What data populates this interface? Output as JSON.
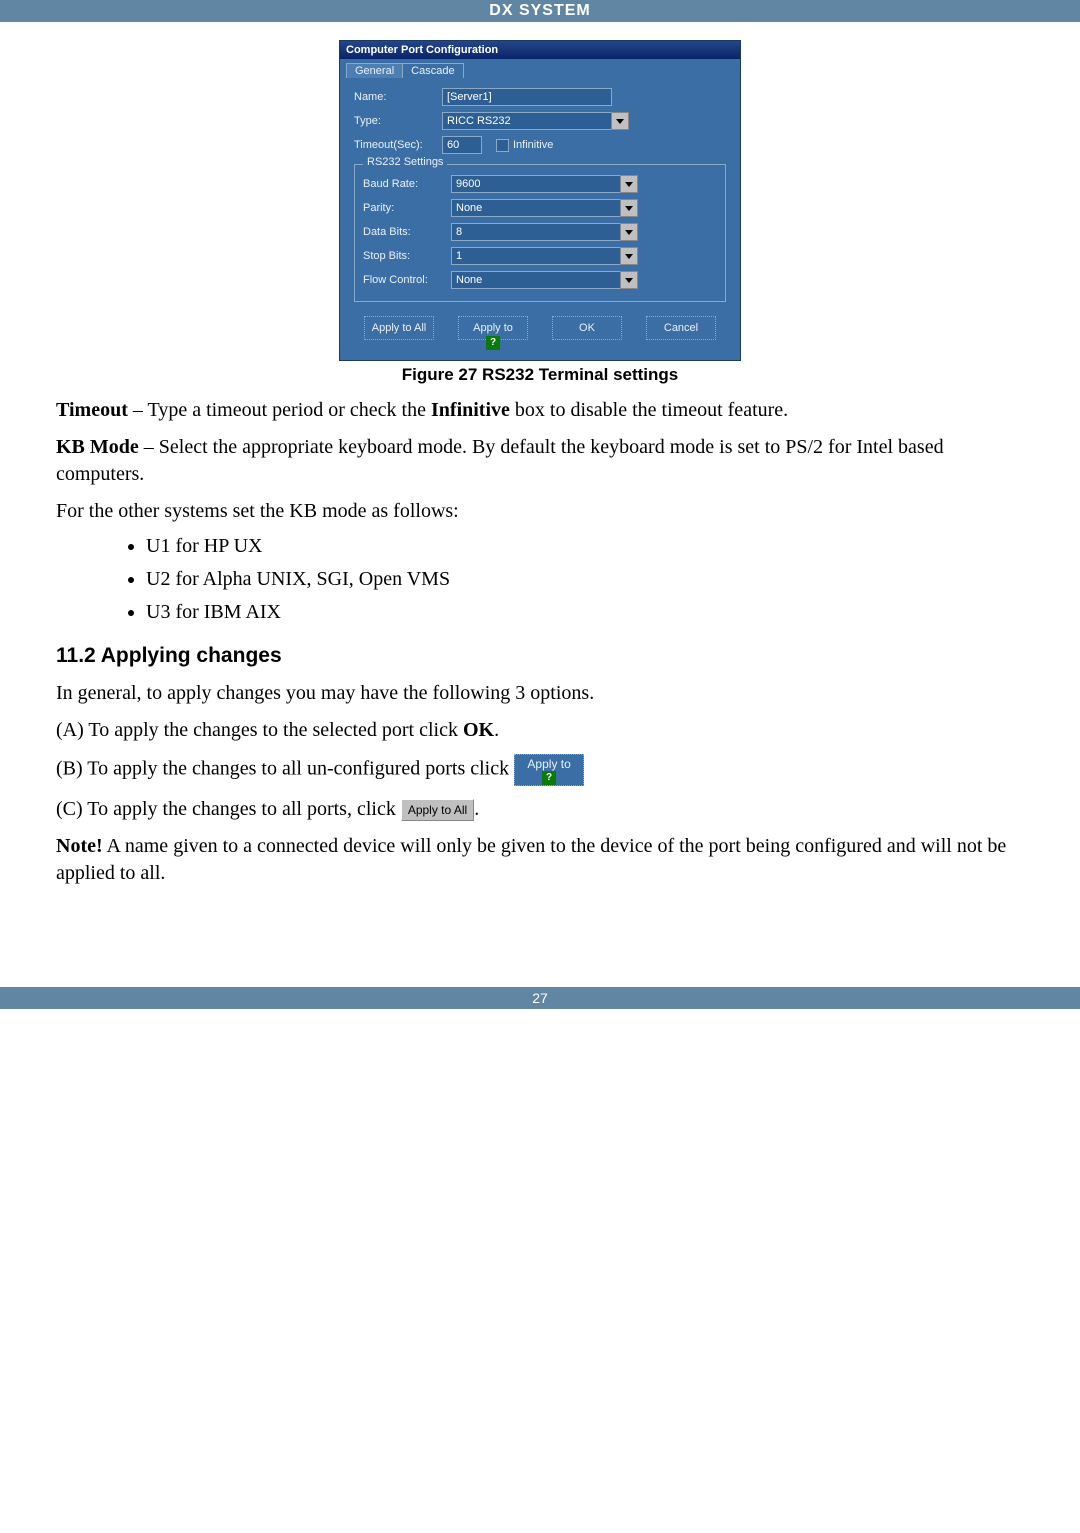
{
  "header": {
    "title": "DX SYSTEM"
  },
  "dialog": {
    "title": "Computer Port Configuration",
    "tab_general": "General",
    "tab_cascade": "Cascade",
    "name_label": "Name:",
    "name_value": "[Server1]",
    "type_label": "Type:",
    "type_value": "RICC RS232",
    "timeout_label": "Timeout(Sec):",
    "timeout_value": "60",
    "infinitive_label": "Infinitive",
    "group_title": "RS232 Settings",
    "baud_label": "Baud Rate:",
    "baud_value": "9600",
    "parity_label": "Parity:",
    "parity_value": "None",
    "databits_label": "Data Bits:",
    "databits_value": "8",
    "stopbits_label": "Stop Bits:",
    "stopbits_value": "1",
    "flow_label": "Flow Control:",
    "flow_value": "None",
    "btn_apply_all": "Apply to All",
    "btn_apply_to": "Apply to",
    "btn_ok": "OK",
    "btn_cancel": "Cancel"
  },
  "figure_caption": "Figure 27 RS232 Terminal settings",
  "para_timeout_bold": "Timeout",
  "para_timeout_rest": " – Type a timeout period or check the ",
  "para_timeout_bold2": "Infinitive",
  "para_timeout_rest2": " box to disable the timeout feature.",
  "para_kb_bold": "KB Mode",
  "para_kb_rest": " – Select the appropriate keyboard mode. By default the keyboard mode is set to PS/2 for Intel based computers.",
  "para_for_other": "For the other systems set the KB mode as follows:",
  "kb_list": {
    "i0": "U1 for HP UX",
    "i1": "U2 for Alpha UNIX, SGI, Open VMS",
    "i2": "U3 for IBM AIX"
  },
  "section_heading": "11.2 Applying changes",
  "para_general": "In general, to apply changes you may have the following 3 options.",
  "para_a_pre": "(A) To apply the changes to the selected port click ",
  "para_a_bold": "OK",
  "para_a_post": ".",
  "para_b_pre": "(B) To apply the changes to all un-configured ports click ",
  "inline_applyto": "Apply to",
  "para_c_pre": "(C) To apply the changes to all ports, click ",
  "inline_applyall": "Apply to All",
  "para_c_post": ".",
  "note_bold": "Note!",
  "note_rest": " A name given to a connected device will only be given to the device of the port being configured and will not be applied to all.",
  "footer": {
    "page": "27"
  }
}
